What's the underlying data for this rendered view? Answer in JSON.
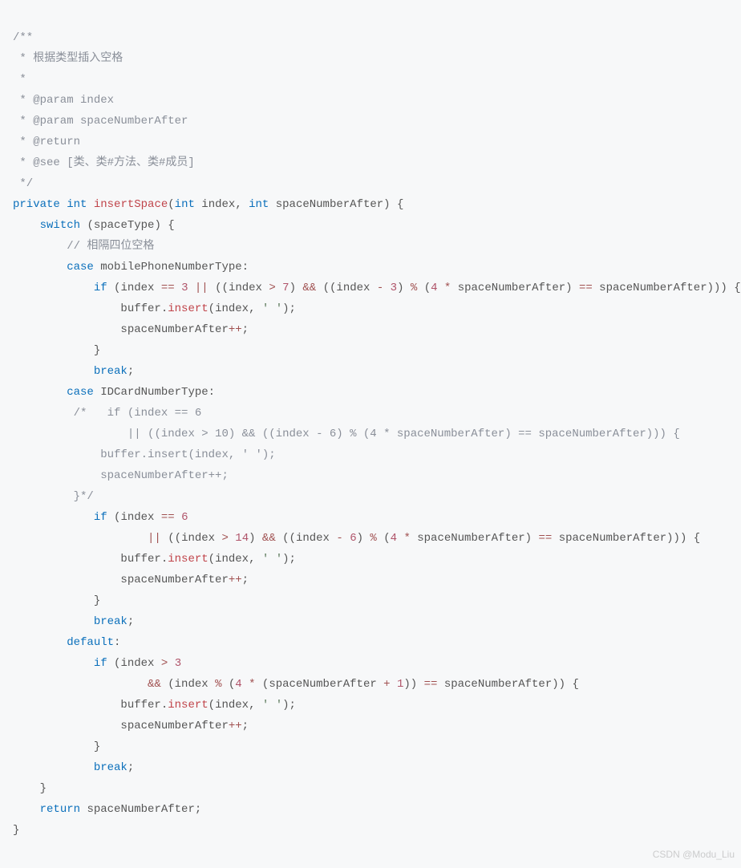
{
  "watermark": "CSDN @Modu_Liu",
  "code": {
    "doc": {
      "open": "/**",
      "l1": " * 根据类型插入空格",
      "l2": " *",
      "p1": " * @param index",
      "p2": " * @param spaceNumberAfter",
      "ret": " * @return",
      "see": " * @see [类、类#方法、类#成员]",
      "close": " */"
    },
    "kw": {
      "private": "private",
      "int": "int",
      "switch": "switch",
      "case": "case",
      "if": "if",
      "break": "break",
      "default": "default",
      "return": "return"
    },
    "fn": {
      "insertSpace": "insertSpace",
      "insert": "insert"
    },
    "id": {
      "index": "index",
      "spaceNumberAfter": "spaceNumberAfter",
      "spaceType": "spaceType",
      "mobilePhoneNumberType": "mobilePhoneNumberType",
      "IDCardNumberType": "IDCardNumberType",
      "buffer": "buffer"
    },
    "num": {
      "n1": "1",
      "n3": "3",
      "n4": "4",
      "n6": "6",
      "n7": "7",
      "n10": "10",
      "n14": "14"
    },
    "op": {
      "eqeq": "==",
      "oror": "||",
      "andand": "&&",
      "gt": ">",
      "minus": "-",
      "pct": "%",
      "star": "*",
      "plus": "+",
      "pluseq": "++"
    },
    "str": {
      "space": "' '"
    },
    "cmt": {
      "four": "// 相隔四位空格",
      "blk1": "/*   if (index == 6",
      "blk2": "        || ((index > 10) && ((index - 6) % (4 * spaceNumberAfter) == spaceNumberAfter))) {",
      "blk3": "    buffer.insert(index, ' ');",
      "blk4": "    spaceNumberAfter++;",
      "blk5": "}*/"
    },
    "pn": {
      "lp": "(",
      "rp": ")",
      "lb": "{",
      "rb": "}",
      "col": ":",
      "semi": ";",
      "comma": ",",
      "dot": "."
    }
  }
}
